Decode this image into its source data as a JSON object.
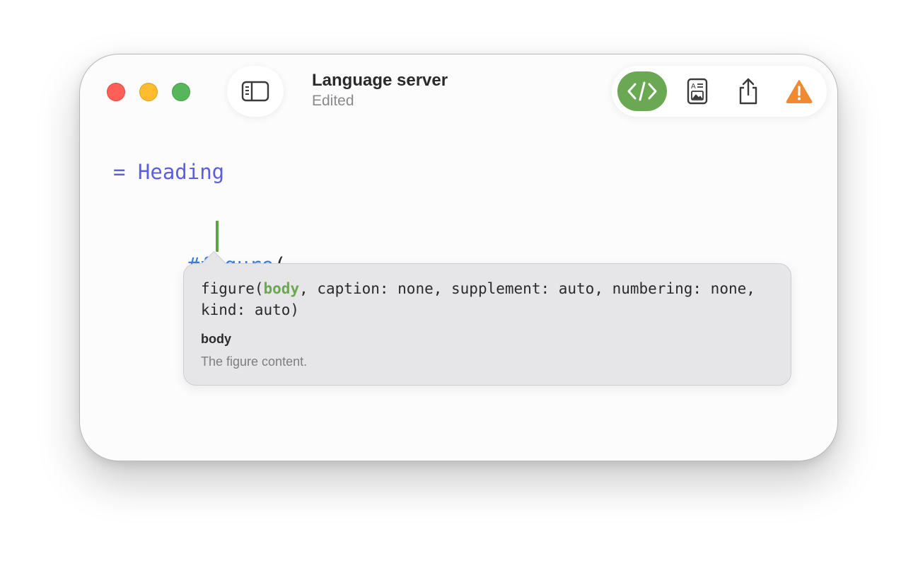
{
  "window": {
    "title": "Language server",
    "subtitle": "Edited"
  },
  "toolbar": {
    "buttons": [
      {
        "name": "source-code",
        "icon": "code-brackets-icon",
        "active": true,
        "color": "#6aa853"
      },
      {
        "name": "preview",
        "icon": "document-preview-icon",
        "active": false
      },
      {
        "name": "share",
        "icon": "share-icon",
        "active": false
      },
      {
        "name": "warning",
        "icon": "warning-triangle-icon",
        "active": false,
        "color": "#ef8a32"
      }
    ]
  },
  "editor": {
    "heading_line": "= Heading",
    "code_function": "#figure",
    "code_paren": "(",
    "heading_color": "#5b5fe0",
    "function_color": "#3c7fe0",
    "cursor_color": "#5aa540"
  },
  "signature_help": {
    "function_name": "figure",
    "open_paren": "(",
    "active_param": "body",
    "rest_of_signature": ", caption: none, supplement: auto, numbering: none, kind: auto)",
    "param_label": "body",
    "param_description": "The figure content."
  }
}
